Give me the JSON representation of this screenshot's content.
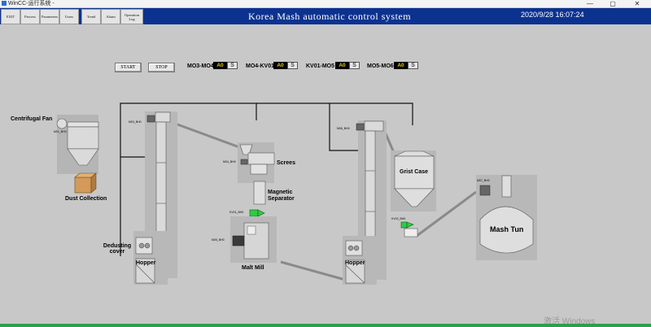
{
  "window": {
    "title": "WinCC-运行系统 - ",
    "minimize": "—",
    "maximize": "▢",
    "close": "✕"
  },
  "nav": [
    {
      "id": "exit",
      "label": "EXIT"
    },
    {
      "id": "process",
      "label": "Process"
    },
    {
      "id": "parameters",
      "label": "Parameters"
    },
    {
      "id": "users",
      "label": "Users"
    },
    {
      "id": "trend",
      "label": "Trend"
    },
    {
      "id": "alarm",
      "label": "Alarm"
    },
    {
      "id": "oplog",
      "label": "Operation Log"
    }
  ],
  "header": {
    "title": "Korea  Mash automatic control system",
    "datetime": "2020/9/28 16:07:24"
  },
  "controls": {
    "start": "START",
    "stop": "STOP"
  },
  "interlocks": [
    {
      "label": "MO3-MO4",
      "value": "A0",
      "mode": "S"
    },
    {
      "label": "MO4-KV01",
      "value": "A0",
      "mode": "S"
    },
    {
      "label": "KV01-MO5",
      "value": "A0",
      "mode": "S"
    },
    {
      "label": "MO5-MO6",
      "value": "A0",
      "mode": "S"
    }
  ],
  "labels": {
    "centrifugal_fan": "Centrifugal Fan",
    "dust_collection": "Dust Collection",
    "dedusting_cover": "Dedusting cover",
    "hopper1": "Hopper",
    "hopper2": "Hopper",
    "screes": "Screes",
    "magnetic_separator": "Magnetic Separator",
    "malt_mill": "Malt Mill",
    "grist_case": "Grist Case",
    "mash_tun": "Mash Tun"
  },
  "tags": {
    "m01": "M01_BH0",
    "m03": "M03_BH0",
    "m04": "M04_BH0",
    "kv01": "KV01_BH0",
    "m05": "M05_BH0",
    "m06": "M06_BH0",
    "kv02": "KV02_BH0",
    "m07": "M07_BH0"
  },
  "watermark": "激活 Windows",
  "colors": {
    "topbar": "#0c3290",
    "background": "#c8c8c8",
    "indicator_value": "#e8d000",
    "valve_green": "#2ecc40"
  }
}
